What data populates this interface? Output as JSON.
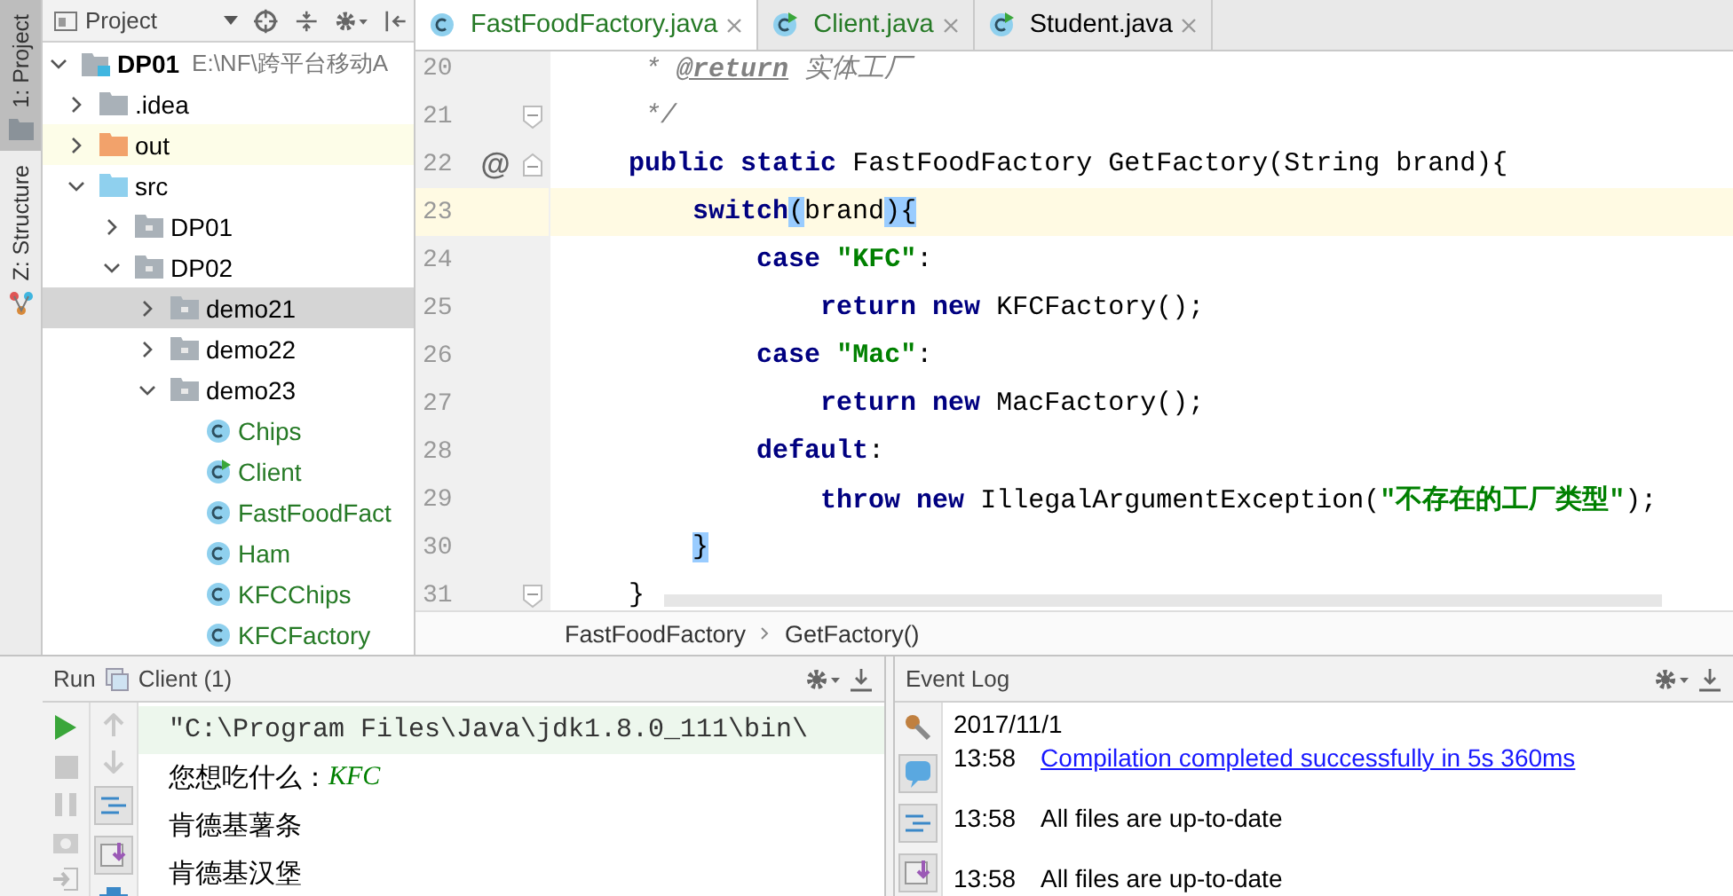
{
  "tool_strip": [
    {
      "label": "1: Project",
      "selected": true
    },
    {
      "label": "Z: Structure",
      "selected": false
    }
  ],
  "project_panel": {
    "title": "Project",
    "tree": [
      {
        "name": "DP01",
        "path": "E:\\NF\\跨平台移动A",
        "kind": "module",
        "expanded": true,
        "selected": false,
        "children": [
          {
            "name": ".idea",
            "kind": "folder",
            "expanded": false,
            "selected": false
          },
          {
            "name": "out",
            "kind": "excluded-folder",
            "expanded": false,
            "selected": false
          },
          {
            "name": "src",
            "kind": "source-folder",
            "expanded": true,
            "selected": false,
            "children": [
              {
                "name": "DP01",
                "kind": "package",
                "expanded": false,
                "selected": false
              },
              {
                "name": "DP02",
                "kind": "package",
                "expanded": true,
                "selected": false,
                "children": [
                  {
                    "name": "demo21",
                    "kind": "package",
                    "expanded": false,
                    "selected": true
                  },
                  {
                    "name": "demo22",
                    "kind": "package",
                    "expanded": false,
                    "selected": false
                  },
                  {
                    "name": "demo23",
                    "kind": "package",
                    "expanded": true,
                    "selected": false,
                    "children": [
                      {
                        "name": "Chips",
                        "kind": "class",
                        "selected": false
                      },
                      {
                        "name": "Client",
                        "kind": "main-class",
                        "selected": false
                      },
                      {
                        "name": "FastFoodFact",
                        "kind": "class",
                        "selected": false
                      },
                      {
                        "name": "Ham",
                        "kind": "class",
                        "selected": false
                      },
                      {
                        "name": "KFCChips",
                        "kind": "class",
                        "selected": false
                      },
                      {
                        "name": "KFCFactory",
                        "kind": "class",
                        "selected": false
                      }
                    ]
                  }
                ]
              }
            ]
          }
        ]
      }
    ]
  },
  "editor": {
    "tabs": [
      {
        "label": "FastFoodFactory.java",
        "kind": "class",
        "added": true,
        "selected": true
      },
      {
        "label": "Client.java",
        "kind": "main-class",
        "added": true,
        "selected": false
      },
      {
        "label": "Student.java",
        "kind": "main-class",
        "added": false,
        "selected": false
      }
    ],
    "lines": [
      {
        "number": "20",
        "current": false,
        "tokens": [
          {
            "text": "     * ",
            "kind": "comment"
          },
          {
            "text": "@return",
            "kind": "doctag"
          },
          {
            "text": " 实体工厂",
            "kind": "comment"
          }
        ]
      },
      {
        "number": "21",
        "current": false,
        "fold_end": true,
        "tokens": [
          {
            "text": "     */",
            "kind": "comment"
          }
        ]
      },
      {
        "number": "22",
        "current": false,
        "fold_start": true,
        "gutter_mark": "@",
        "tokens": [
          {
            "text": "    public static",
            "kind": "keyword"
          },
          {
            "text": " FastFoodFactory GetFactory(String brand){",
            "kind": "plain"
          }
        ]
      },
      {
        "number": "23",
        "current": true,
        "tokens": [
          {
            "text": "        switch",
            "kind": "keyword"
          },
          {
            "text": "(",
            "kind": "match"
          },
          {
            "text": "brand",
            "kind": "plain"
          },
          {
            "text": ")",
            "kind": "match"
          },
          {
            "text": "{",
            "kind": "match"
          }
        ]
      },
      {
        "number": "24",
        "current": false,
        "tokens": [
          {
            "text": "            case",
            "kind": "keyword"
          },
          {
            "text": " \"KFC\"",
            "kind": "string"
          },
          {
            "text": ":",
            "kind": "plain"
          }
        ]
      },
      {
        "number": "25",
        "current": false,
        "tokens": [
          {
            "text": "                return new",
            "kind": "keyword"
          },
          {
            "text": " KFCFactory();",
            "kind": "plain"
          }
        ]
      },
      {
        "number": "26",
        "current": false,
        "tokens": [
          {
            "text": "            case",
            "kind": "keyword"
          },
          {
            "text": " \"Mac\"",
            "kind": "string"
          },
          {
            "text": ":",
            "kind": "plain"
          }
        ]
      },
      {
        "number": "27",
        "current": false,
        "tokens": [
          {
            "text": "                return new",
            "kind": "keyword"
          },
          {
            "text": " MacFactory();",
            "kind": "plain"
          }
        ]
      },
      {
        "number": "28",
        "current": false,
        "tokens": [
          {
            "text": "            default",
            "kind": "keyword"
          },
          {
            "text": ":",
            "kind": "plain"
          }
        ]
      },
      {
        "number": "29",
        "current": false,
        "tokens": [
          {
            "text": "                throw new",
            "kind": "keyword"
          },
          {
            "text": " IllegalArgumentException(",
            "kind": "plain"
          },
          {
            "text": "\"不存在的工厂类型\"",
            "kind": "string"
          },
          {
            "text": ");",
            "kind": "plain"
          }
        ]
      },
      {
        "number": "30",
        "current": false,
        "tokens": [
          {
            "text": "        }",
            "kind": "match"
          }
        ]
      },
      {
        "number": "31",
        "current": false,
        "fold_end": true,
        "tokens": [
          {
            "text": "    }",
            "kind": "plain"
          }
        ]
      }
    ],
    "breadcrumb": [
      "FastFoodFactory",
      "GetFactory()"
    ]
  },
  "run_panel": {
    "title": "Run",
    "config": "Client (1)",
    "lines": [
      {
        "segments": [
          {
            "text": "\"C:\\Program Files\\Java\\jdk1.8.0_111\\bin\\",
            "kind": "command"
          }
        ]
      },
      {
        "segments": [
          {
            "text": "您想吃什么：",
            "kind": "output"
          },
          {
            "text": "KFC",
            "kind": "input"
          }
        ]
      },
      {
        "segments": [
          {
            "text": "肯德基薯条",
            "kind": "output"
          }
        ]
      },
      {
        "segments": [
          {
            "text": "肯德基汉堡",
            "kind": "output"
          }
        ]
      }
    ]
  },
  "event_log": {
    "title": "Event Log",
    "entries": [
      {
        "kind": "date",
        "text": "2017/11/1"
      },
      {
        "kind": "event",
        "time": "13:58",
        "message": "Compilation completed successfully in 5s 360ms",
        "link": true
      },
      {
        "kind": "event",
        "time": "13:58",
        "message": "All files are up-to-date",
        "link": false
      },
      {
        "kind": "event",
        "time": "13:58",
        "message": "All files are up-to-date",
        "link": false
      }
    ]
  }
}
